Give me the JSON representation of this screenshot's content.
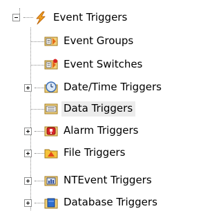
{
  "tree": {
    "root": {
      "label": "Event Triggers",
      "icon": "lightning-icon",
      "expanded": true
    },
    "children": [
      {
        "label": "Event Groups",
        "icon": "event-groups-icon",
        "expandable": false
      },
      {
        "label": "Event Switches",
        "icon": "event-switches-icon",
        "expandable": false
      },
      {
        "label": "Date/Time Triggers",
        "icon": "clock-icon",
        "expandable": true
      },
      {
        "label": "Data Triggers",
        "icon": "data-triggers-icon",
        "expandable": false,
        "selected": true
      },
      {
        "label": "Alarm Triggers",
        "icon": "alarm-icon",
        "expandable": true
      },
      {
        "label": "File Triggers",
        "icon": "file-triggers-icon",
        "expandable": true
      },
      {
        "label": "NTEvent Triggers",
        "icon": "ntevent-icon",
        "expandable": true
      },
      {
        "label": "Database Triggers",
        "icon": "database-icon",
        "expandable": true
      }
    ]
  },
  "colors": {
    "selection": "#ececec",
    "tree_line": "#8a8a8a",
    "lightning": "#f0a020",
    "folder": "#f5c33b"
  }
}
